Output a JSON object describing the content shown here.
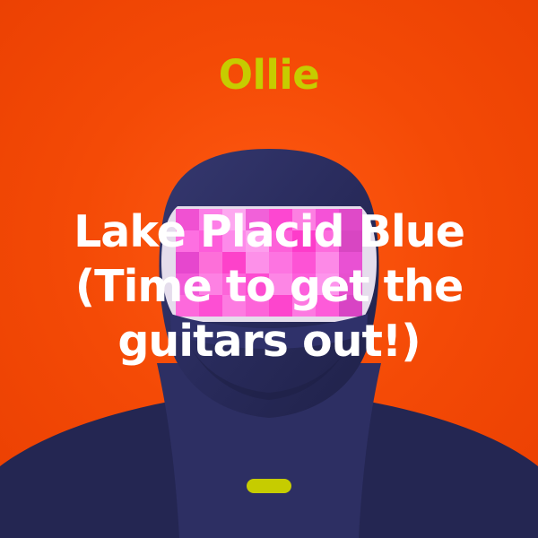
{
  "cover": {
    "artist": "Ollie",
    "title_lines": [
      "Lake Placid Blue",
      "(Time to get the",
      "guitars out!)"
    ]
  },
  "colors": {
    "background": "#f44a06",
    "artist_text": "#c6cc00",
    "title_text": "#ffffff",
    "hood": "#2d2f63",
    "censor_block": "#ff47d8",
    "indicator": "#c6cc00"
  }
}
